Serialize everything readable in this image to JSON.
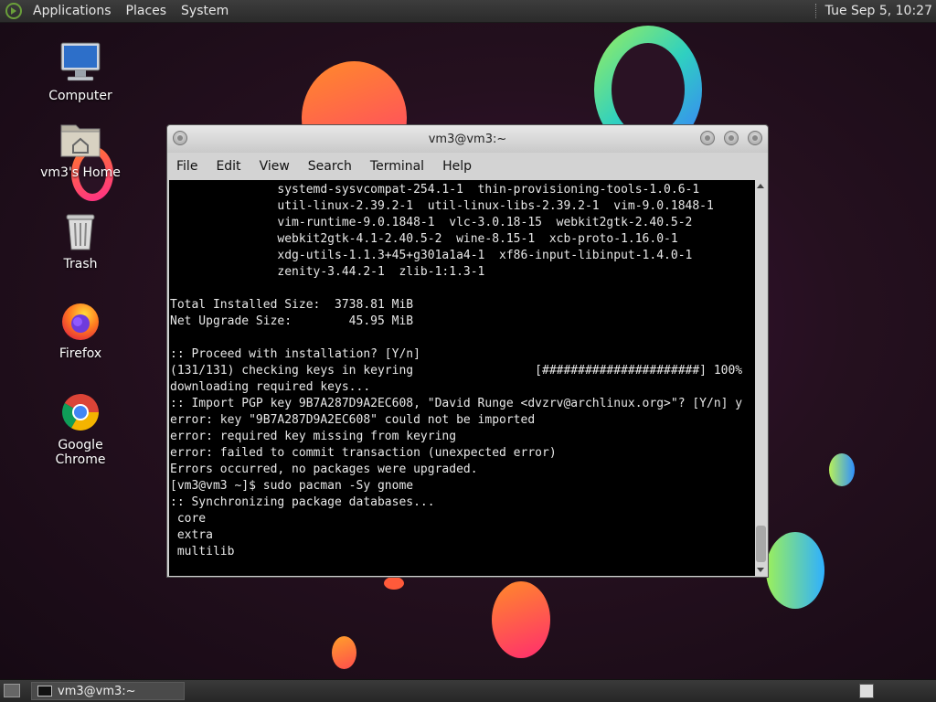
{
  "top_panel": {
    "menus": [
      "Applications",
      "Places",
      "System"
    ],
    "clock": "Tue Sep  5, 10:27"
  },
  "desktop_icons": [
    {
      "label": "Computer",
      "icon": "computer-icon"
    },
    {
      "label": "vm3's Home",
      "icon": "home-folder-icon"
    },
    {
      "label": "Trash",
      "icon": "trash-icon"
    },
    {
      "label": "Firefox",
      "icon": "firefox-icon"
    },
    {
      "label": "Google Chrome",
      "icon": "chrome-icon"
    }
  ],
  "terminal": {
    "title": "vm3@vm3:~",
    "menus": [
      "File",
      "Edit",
      "View",
      "Search",
      "Terminal",
      "Help"
    ],
    "lines": [
      "               systemd-sysvcompat-254.1-1  thin-provisioning-tools-1.0.6-1",
      "               util-linux-2.39.2-1  util-linux-libs-2.39.2-1  vim-9.0.1848-1",
      "               vim-runtime-9.0.1848-1  vlc-3.0.18-15  webkit2gtk-2.40.5-2",
      "               webkit2gtk-4.1-2.40.5-2  wine-8.15-1  xcb-proto-1.16.0-1",
      "               xdg-utils-1.1.3+45+g301a1a4-1  xf86-input-libinput-1.4.0-1",
      "               zenity-3.44.2-1  zlib-1:1.3-1",
      "",
      "Total Installed Size:  3738.81 MiB",
      "Net Upgrade Size:        45.95 MiB",
      "",
      ":: Proceed with installation? [Y/n]",
      "(131/131) checking keys in keyring                 [######################] 100%",
      "downloading required keys...",
      ":: Import PGP key 9B7A287D9A2EC608, \"David Runge <dvzrv@archlinux.org>\"? [Y/n] y",
      "error: key \"9B7A287D9A2EC608\" could not be imported",
      "error: required key missing from keyring",
      "error: failed to commit transaction (unexpected error)",
      "Errors occurred, no packages were upgraded.",
      "[vm3@vm3 ~]$ sudo pacman -Sy gnome",
      ":: Synchronizing package databases...",
      " core",
      " extra",
      " multilib"
    ]
  },
  "taskbar": {
    "window_label": "vm3@vm3:~"
  }
}
